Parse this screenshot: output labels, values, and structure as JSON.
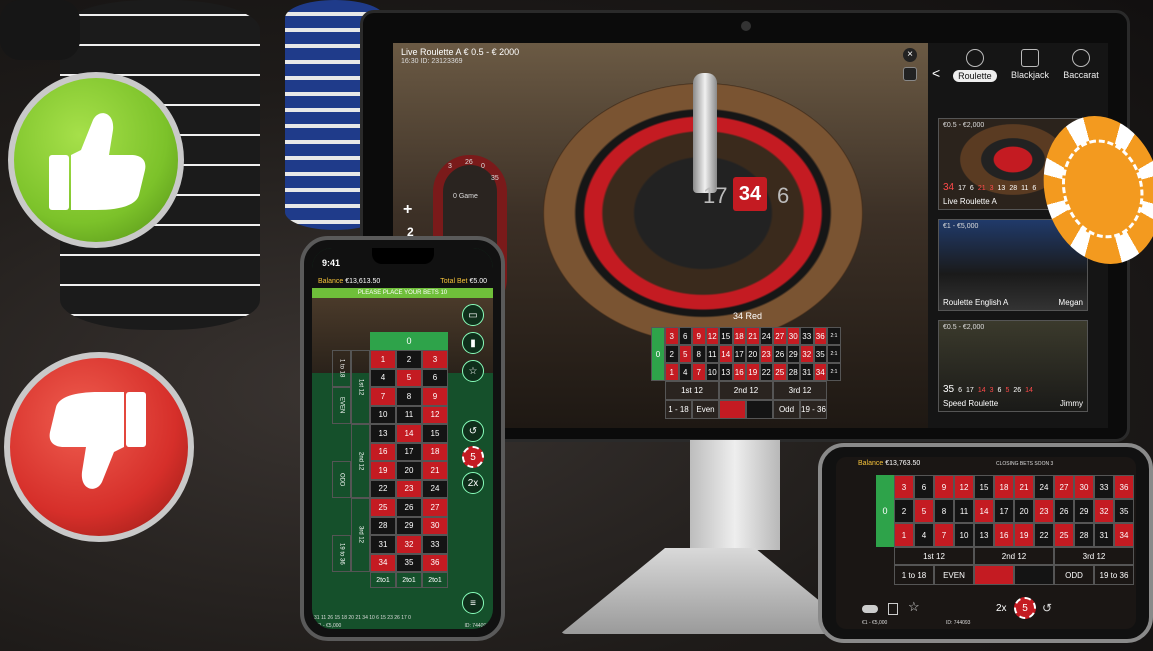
{
  "monitor": {
    "table_title": "Live Roulette A",
    "limits": "€ 0.5 - € 2000",
    "time": "16:30",
    "game_id": "ID: 23123369",
    "result_label": "34 Red",
    "winning_number": "34",
    "wheel_left_number": "17",
    "wheel_right_number": "6",
    "race_zero": "0 Game",
    "race_numbers": [
      "3",
      "26",
      "0",
      "35"
    ],
    "plus_sign": "+",
    "side_count": "2",
    "back_arrow": "<",
    "tabs": [
      {
        "label": "Roulette",
        "icon": "roulette-icon"
      },
      {
        "label": "Blackjack",
        "icon": "cards-icon"
      },
      {
        "label": "Baccarat",
        "icon": "baccarat-icon"
      }
    ],
    "lobby_cards": [
      {
        "limits": "€0.5 - €2,000",
        "name": "Live Roulette A",
        "host": "",
        "last_results": [
          "34",
          "17",
          "6",
          "21",
          "3",
          "13",
          "28",
          "11",
          "6"
        ]
      },
      {
        "limits": "€1 - €5,000",
        "name": "Roulette English A",
        "host": "Megan",
        "last_results": []
      },
      {
        "limits": "€0.5 - €2,000",
        "name": "Speed Roulette",
        "host": "Jimmy",
        "last_results": [
          "35",
          "6",
          "17",
          "14",
          "3",
          "6",
          "5",
          "26",
          "14"
        ]
      }
    ],
    "board_rows": [
      [
        "3",
        "6",
        "9",
        "12",
        "15",
        "18",
        "21",
        "24",
        "27",
        "30",
        "33",
        "36"
      ],
      [
        "2",
        "5",
        "8",
        "11",
        "14",
        "17",
        "20",
        "23",
        "26",
        "29",
        "32",
        "35"
      ],
      [
        "1",
        "4",
        "7",
        "10",
        "13",
        "16",
        "19",
        "22",
        "25",
        "28",
        "31",
        "34"
      ]
    ],
    "board_dozens": [
      "1st 12",
      "2nd 12",
      "3rd 12"
    ],
    "board_outside": [
      "1 - 18",
      "Even",
      "",
      "",
      "Odd",
      "19 - 36"
    ],
    "board_zero": "0",
    "board_columns": [
      "2:1",
      "2:1",
      "2:1"
    ]
  },
  "phone": {
    "time": "9:41",
    "balance_label": "Balance",
    "balance_value": "€13,613.50",
    "total_bet_label": "Total Bet",
    "total_bet_value": "€5.00",
    "banner": "PLEASE PLACE YOUR BETS 10",
    "zero": "0",
    "side_labels": [
      "1 to 18",
      "1st 12",
      "EVEN",
      "2nd 12",
      "ODD",
      "3rd 12",
      "19 to 36"
    ],
    "columns": [
      "2to1",
      "2to1",
      "2to1"
    ],
    "numbers": [
      [
        "1",
        "2",
        "3"
      ],
      [
        "4",
        "5",
        "6"
      ],
      [
        "7",
        "8",
        "9"
      ],
      [
        "10",
        "11",
        "12"
      ],
      [
        "13",
        "14",
        "15"
      ],
      [
        "16",
        "17",
        "18"
      ],
      [
        "19",
        "20",
        "21"
      ],
      [
        "22",
        "23",
        "24"
      ],
      [
        "25",
        "26",
        "27"
      ],
      [
        "28",
        "29",
        "30"
      ],
      [
        "31",
        "32",
        "33"
      ],
      [
        "34",
        "35",
        "36"
      ]
    ],
    "chip_value": "5",
    "multiplier": "2x",
    "history": "31 11 26 15 18 20 21 34 10 6 15 23 26 17 0",
    "limits_footer": "€1 - €5,000",
    "id_footer": "ID: 744093"
  },
  "phone2": {
    "balance_label": "Balance",
    "balance_value": "€13,763.50",
    "status": "CLOSING BETS SOON 3",
    "zero": "0",
    "rows": [
      [
        "3",
        "6",
        "9",
        "12",
        "15",
        "18",
        "21",
        "24",
        "27",
        "30",
        "33",
        "36"
      ],
      [
        "2",
        "5",
        "8",
        "11",
        "14",
        "17",
        "20",
        "23",
        "26",
        "29",
        "32",
        "35"
      ],
      [
        "1",
        "4",
        "7",
        "10",
        "13",
        "16",
        "19",
        "22",
        "25",
        "28",
        "31",
        "34"
      ]
    ],
    "dozens": [
      "1st 12",
      "2nd 12",
      "3rd 12"
    ],
    "outside": [
      "1 to 18",
      "EVEN",
      "",
      "",
      "ODD",
      "19 to 36"
    ],
    "multiplier": "2x",
    "chip_value": "5",
    "limits_footer": "€1 - €5,000",
    "id_footer": "ID: 744093"
  },
  "colors": {
    "red": "#c41b22",
    "black": "#141414",
    "green": "#2ea34a",
    "thumb_up": "#7cc22a",
    "thumb_down": "#d62f2a",
    "chip_orange": "#f39a1f"
  }
}
